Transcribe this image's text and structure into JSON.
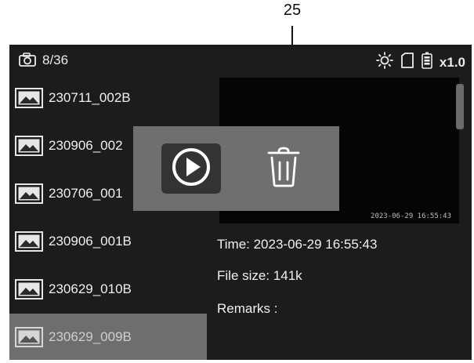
{
  "callout": {
    "number": "25"
  },
  "status_bar": {
    "photo_count": "8/36",
    "zoom": "x1.0",
    "icons": [
      "camera-icon",
      "brightness-icon",
      "sd-card-icon",
      "battery-icon"
    ]
  },
  "files": [
    {
      "name": "230711_002B",
      "selected": false
    },
    {
      "name": "230906_002",
      "selected": false
    },
    {
      "name": "230706_001",
      "selected": false
    },
    {
      "name": "230906_001B",
      "selected": false
    },
    {
      "name": "230629_010B",
      "selected": false
    },
    {
      "name": "230629_009B",
      "selected": true
    }
  ],
  "preview": {
    "timestamp": "2023-06-29 16:55:43"
  },
  "details": {
    "time": "Time: 2023-06-29  16:55:43",
    "file_size": "File size: 141k",
    "remarks": "Remarks :"
  },
  "popup": {
    "actions": [
      "play-icon",
      "trash-icon"
    ]
  },
  "colors": {
    "screen_bg": "#1c1c1c",
    "selected_bg": "#6e6e6e",
    "popup_bg": "#6f6f6f",
    "text": "#f0f0f0"
  }
}
